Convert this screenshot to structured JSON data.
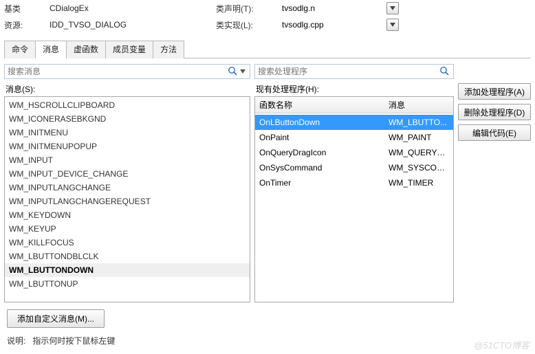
{
  "top": {
    "row0": {
      "left_label": "基类",
      "left_value": "CDialogEx",
      "mid_label": "类声明(T):",
      "right_value": "tvsodlg.n"
    },
    "row1": {
      "left_label": "资源:",
      "left_value": "IDD_TVSO_DIALOG",
      "mid_label": "类实现(L):",
      "right_value": "tvsodlg.cpp"
    }
  },
  "tabs": [
    {
      "label": "命令",
      "active": false
    },
    {
      "label": "消息",
      "active": true
    },
    {
      "label": "虚函数",
      "active": false
    },
    {
      "label": "成员变量",
      "active": false
    },
    {
      "label": "方法",
      "active": false
    }
  ],
  "left": {
    "search_placeholder": "搜索消息",
    "section_label": "消息(S):",
    "items": [
      "WM_HSCROLLCLIPBOARD",
      "WM_ICONERASEBKGND",
      "WM_INITMENU",
      "WM_INITMENUPOPUP",
      "WM_INPUT",
      "WM_INPUT_DEVICE_CHANGE",
      "WM_INPUTLANGCHANGE",
      "WM_INPUTLANGCHANGEREQUEST",
      "WM_KEYDOWN",
      "WM_KEYUP",
      "WM_KILLFOCUS",
      "WM_LBUTTONDBLCLK",
      "WM_LBUTTONDOWN",
      "WM_LBUTTONUP"
    ],
    "bold_index": 12
  },
  "right": {
    "search_placeholder": "搜索处理程序",
    "section_label": "现有处理程序(H):",
    "col_fn": "函数名称",
    "col_msg": "消息",
    "rows": [
      {
        "fn": "OnLButtonDown",
        "msg": "WM_LBUTTO..."
      },
      {
        "fn": "OnPaint",
        "msg": "WM_PAINT"
      },
      {
        "fn": "OnQueryDragIcon",
        "msg": "WM_QUERYD..."
      },
      {
        "fn": "OnSysCommand",
        "msg": "WM_SYSCOM..."
      },
      {
        "fn": "OnTimer",
        "msg": "WM_TIMER"
      }
    ],
    "selected_index": 0
  },
  "buttons": {
    "add": "添加处理程序(A)",
    "del": "删除处理程序(D)",
    "edit": "编辑代码(E)"
  },
  "bottom": {
    "custom": "添加自定义消息(M)...",
    "explain_label": "说明:",
    "explain_text": "指示何时按下鼠标左键"
  },
  "watermark": "@51CTO博客"
}
